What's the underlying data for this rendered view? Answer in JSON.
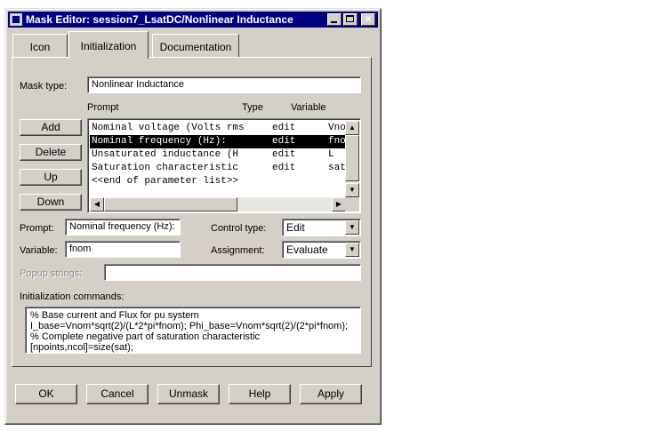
{
  "window": {
    "title": "Mask Editor: session7_LsatDC/Nonlinear Inductance"
  },
  "title_buttons": {
    "minimize": "_",
    "maximize": "□",
    "close": "×"
  },
  "tabs": [
    {
      "label": "Icon",
      "active": false
    },
    {
      "label": "Initialization",
      "active": true
    },
    {
      "label": "Documentation",
      "active": false
    }
  ],
  "mask_type": {
    "label": "Mask type:",
    "value": "Nonlinear Inductance"
  },
  "list_headers": {
    "prompt": "Prompt",
    "type": "Type",
    "variable": "Variable"
  },
  "side_buttons": {
    "add": "Add",
    "delete": "Delete",
    "up": "Up",
    "down": "Down"
  },
  "params": {
    "rows": [
      {
        "prompt": "Nominal voltage (Volts rms",
        "type": "edit",
        "variable": "Vno"
      },
      {
        "prompt": "Nominal frequency (Hz):",
        "type": "edit",
        "variable": "fno"
      },
      {
        "prompt": "Unsaturated inductance (H",
        "type": "edit",
        "variable": "L"
      },
      {
        "prompt": "Saturation characteristic",
        "type": "edit",
        "variable": "sat"
      }
    ],
    "end_marker": "<<end of parameter list>>",
    "selected_index": 1
  },
  "scroll_arrows": {
    "up": "▲",
    "down": "▼",
    "left": "◀",
    "right": "▶"
  },
  "form": {
    "prompt_label": "Prompt:",
    "prompt_value": "Nominal frequency (Hz):",
    "variable_label": "Variable:",
    "variable_value": "fnom",
    "control_type_label": "Control type:",
    "control_type_value": "Edit",
    "assignment_label": "Assignment:",
    "assignment_value": "Evaluate",
    "popup_label": "Popup strings:",
    "popup_value": "",
    "dropdown_arrow": "▼"
  },
  "init_commands": {
    "label": "Initialization commands:",
    "lines": [
      "% Base current and Flux for pu system",
      "I_base=Vnom*sqrt(2)/(L*2*pi*fnom); Phi_base=Vnom*sqrt(2)/(2*pi*fnom);",
      "% Complete negative part of saturation characteristic",
      "[npoints,ncol]=size(sat);"
    ]
  },
  "bottom_buttons": {
    "ok": "OK",
    "cancel": "Cancel",
    "unmask": "Unmask",
    "help": "Help",
    "apply": "Apply"
  }
}
